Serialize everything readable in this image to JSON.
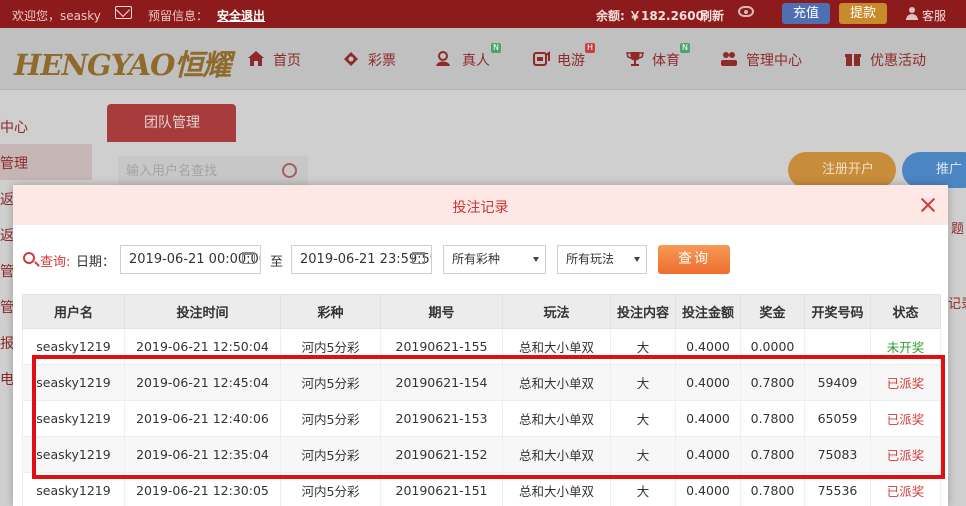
{
  "topbar": {
    "welcome": "欢迎您，seasky",
    "warning_label": "预留信息：",
    "logout": "安全退出",
    "balance": "余额: ￥182.2600",
    "refresh": "刷新",
    "recharge": "充值",
    "withdraw": "提款",
    "service": "客服",
    "colors": {
      "bar": "#8e1b1b",
      "recharge": "#4f6fb5",
      "withdraw": "#c98a2c"
    }
  },
  "logo": {
    "text": "HENGYAO恒耀"
  },
  "nav": {
    "items": [
      {
        "label": "首页",
        "icon": "home-icon"
      },
      {
        "label": "彩票",
        "icon": "lottery-icon"
      },
      {
        "label": "真人",
        "icon": "live-icon",
        "badge": "N"
      },
      {
        "label": "电游",
        "icon": "slot-icon",
        "badge": "H"
      },
      {
        "label": "体育",
        "icon": "trophy-icon",
        "badge": "N"
      },
      {
        "label": "管理中心",
        "icon": "users-icon"
      },
      {
        "label": "优惠活动",
        "icon": "gift-icon"
      }
    ]
  },
  "sidebar": {
    "fragments": [
      "中心",
      "管理",
      "返",
      "返",
      "管",
      "管",
      "报",
      "电"
    ]
  },
  "background": {
    "tab": "团队管理",
    "search_placeholder": "输入用户名查找",
    "register_btn": "注册开户",
    "promote_btn": "推广",
    "frag_right1": "题",
    "frag_right2": "记录"
  },
  "modal": {
    "title": "投注记录",
    "filter": {
      "query_label": "查询:",
      "date_label": "日期：",
      "start": "2019-06-21 00:00:00",
      "to": "至",
      "end": "2019-06-21 23:59:59",
      "lottery": "所有彩种",
      "play": "所有玩法",
      "query_btn": "查询"
    },
    "table": {
      "headers": [
        "用户名",
        "投注时间",
        "彩种",
        "期号",
        "玩法",
        "投注内容",
        "投注金额",
        "奖金",
        "开奖号码",
        "状态"
      ],
      "rows": [
        [
          "seasky1219",
          "2019-06-21 12:50:04",
          "河内5分彩",
          "20190621-155",
          "总和大小单双",
          "大",
          "0.4000",
          "0.0000",
          "",
          "未开奖"
        ],
        [
          "seasky1219",
          "2019-06-21 12:45:04",
          "河内5分彩",
          "20190621-154",
          "总和大小单双",
          "大",
          "0.4000",
          "0.7800",
          "59409",
          "已派奖"
        ],
        [
          "seasky1219",
          "2019-06-21 12:40:06",
          "河内5分彩",
          "20190621-153",
          "总和大小单双",
          "大",
          "0.4000",
          "0.7800",
          "65059",
          "已派奖"
        ],
        [
          "seasky1219",
          "2019-06-21 12:35:04",
          "河内5分彩",
          "20190621-152",
          "总和大小单双",
          "大",
          "0.4000",
          "0.7800",
          "75083",
          "已派奖"
        ],
        [
          "seasky1219",
          "2019-06-21 12:30:05",
          "河内5分彩",
          "20190621-151",
          "总和大小单双",
          "大",
          "0.4000",
          "0.7800",
          "75536",
          "已派奖"
        ]
      ],
      "status_colors": {
        "未开奖": "#2e9a2e",
        "已派奖": "#d43a3a"
      }
    }
  }
}
